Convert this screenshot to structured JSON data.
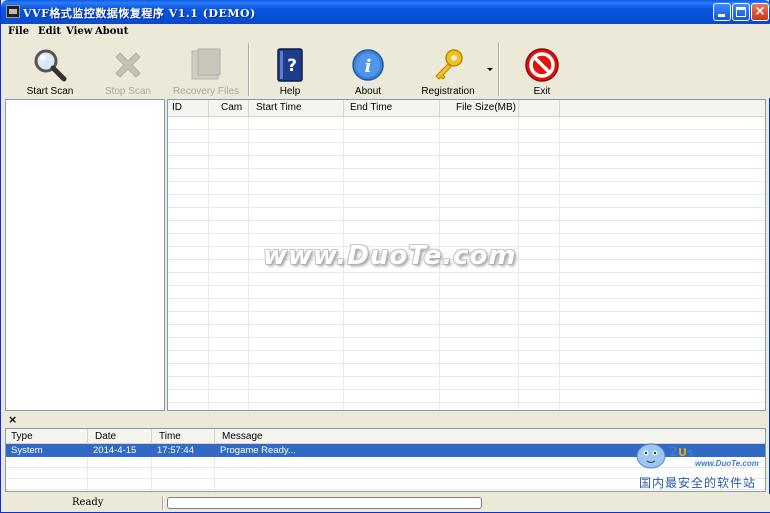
{
  "window": {
    "title": "VVF格式监控数据恢复程序 V1.1 (DEMO)",
    "minimize_label": "_",
    "maximize_label": "□",
    "close_label": "×"
  },
  "menu": {
    "items": [
      "File",
      "Edit",
      "View",
      "About"
    ]
  },
  "toolbar": {
    "buttons": [
      {
        "label": "Start Scan",
        "icon": "magnifier-icon",
        "enabled": true
      },
      {
        "label": "Stop Scan",
        "icon": "stop-x-icon",
        "enabled": false
      },
      {
        "label": "Recovery Files",
        "icon": "recover-icon",
        "enabled": false
      },
      {
        "label": "Help",
        "icon": "help-book-icon",
        "enabled": true
      },
      {
        "label": "About",
        "icon": "info-icon",
        "enabled": true
      },
      {
        "label": "Registration",
        "icon": "key-icon",
        "enabled": true
      },
      {
        "label": "Exit",
        "icon": "exit-icon",
        "enabled": true
      }
    ]
  },
  "grid": {
    "columns": [
      "ID",
      "Cam",
      "Start Time",
      "End Time",
      "File Size(MB)",
      ""
    ],
    "rows": []
  },
  "watermark": "www.DuoTe.com",
  "log": {
    "close_label": "×",
    "columns": [
      "Type",
      "Date",
      "Time",
      "Message"
    ],
    "rows": [
      {
        "type": "System",
        "date": "2014-4-15",
        "time": "17:57:44",
        "message": "Progame Ready...",
        "selected": true
      }
    ]
  },
  "statusbar": {
    "status": "Ready",
    "progress": 0
  },
  "logo": {
    "site": "www.DuoTe.com",
    "slogan": "国内最安全的软件站"
  },
  "colors": {
    "titlebar": "#0a57e0",
    "selection": "#316ac5",
    "face": "#ece9d8"
  }
}
